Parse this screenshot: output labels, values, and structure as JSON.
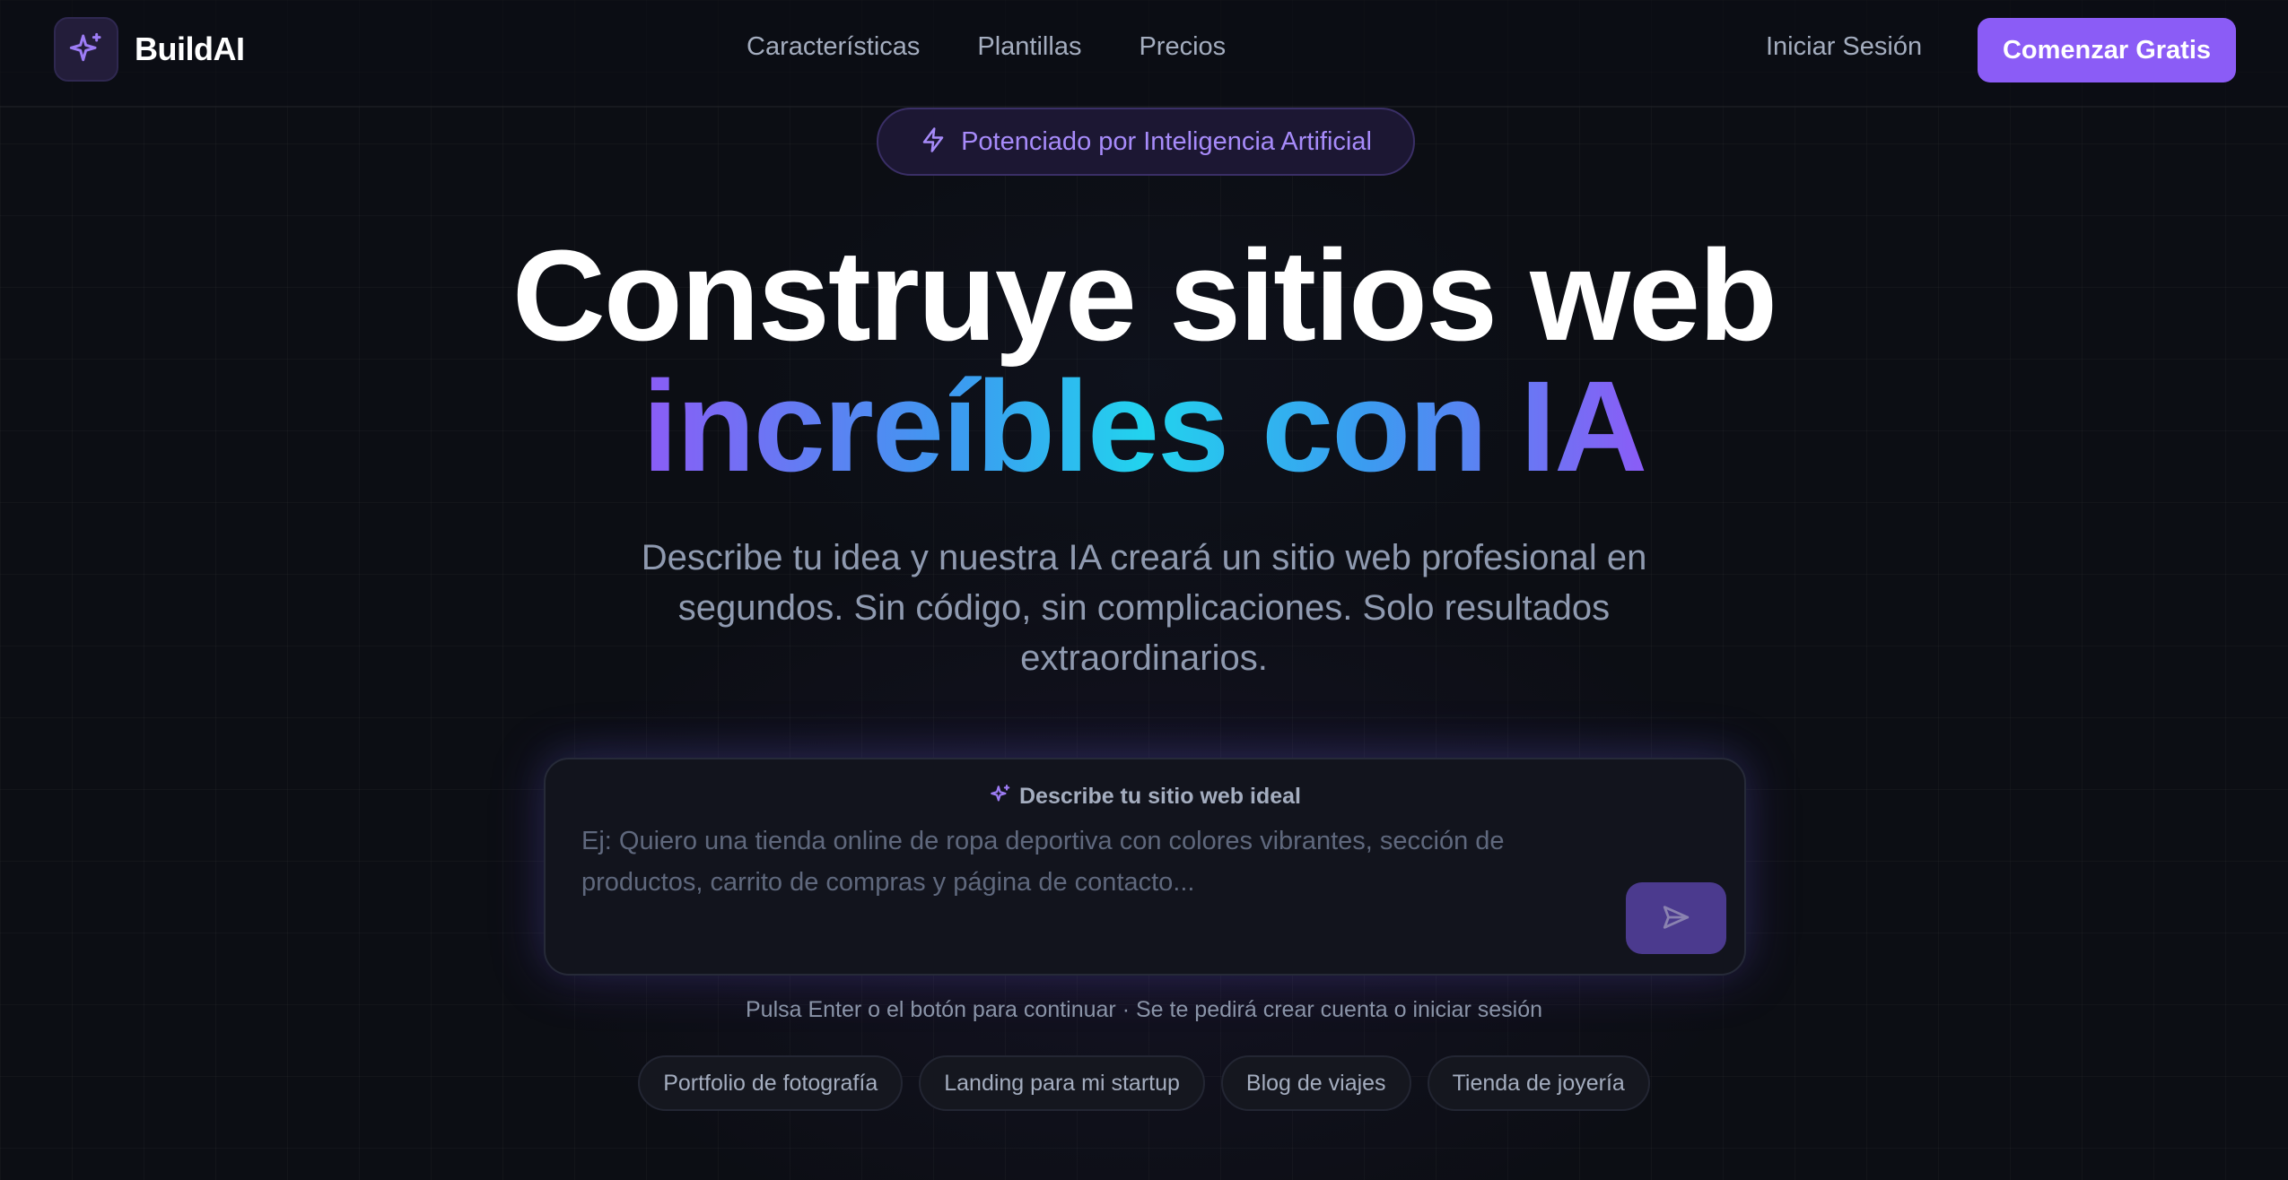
{
  "nav": {
    "brand": "BuildAI",
    "links": [
      "Características",
      "Plantillas",
      "Precios"
    ],
    "login": "Iniciar Sesión",
    "cta": "Comenzar Gratis"
  },
  "badge": {
    "icon": "lightning-icon",
    "text": "Potenciado por Inteligencia Artificial"
  },
  "hero": {
    "line1": "Construye sitios web",
    "line2": "increíbles con IA",
    "subtitle": "Describe tu idea y nuestra IA creará un sitio web profesional en segundos. Sin código, sin complicaciones. Solo resultados extraordinarios."
  },
  "prompt": {
    "label": "Describe tu sitio web ideal",
    "placeholder": "Ej: Quiero una tienda online de ropa deportiva con colores vibrantes, sección de productos, carrito de compras y página de contacto...",
    "value": "",
    "send_icon": "send-icon",
    "hint": "Pulsa Enter o el botón para continuar · Se te pedirá crear cuenta o iniciar sesión"
  },
  "suggestions": [
    "Portfolio de fotografía",
    "Landing para mi startup",
    "Blog de viajes",
    "Tienda de joyería"
  ],
  "colors": {
    "accent": "#8b5cf6",
    "background": "#0c0e14",
    "gradient_start": "#8b5cf6",
    "gradient_mid": "#22d3ee"
  }
}
